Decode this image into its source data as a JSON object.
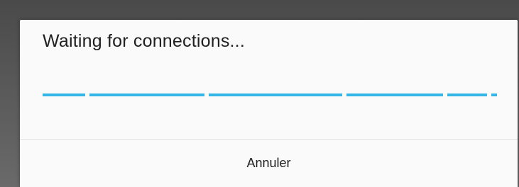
{
  "dialog": {
    "title": "Waiting for connections...",
    "progress": {
      "color": "#33b5e5",
      "indeterminate": true
    },
    "cancel_label": "Annuler"
  }
}
